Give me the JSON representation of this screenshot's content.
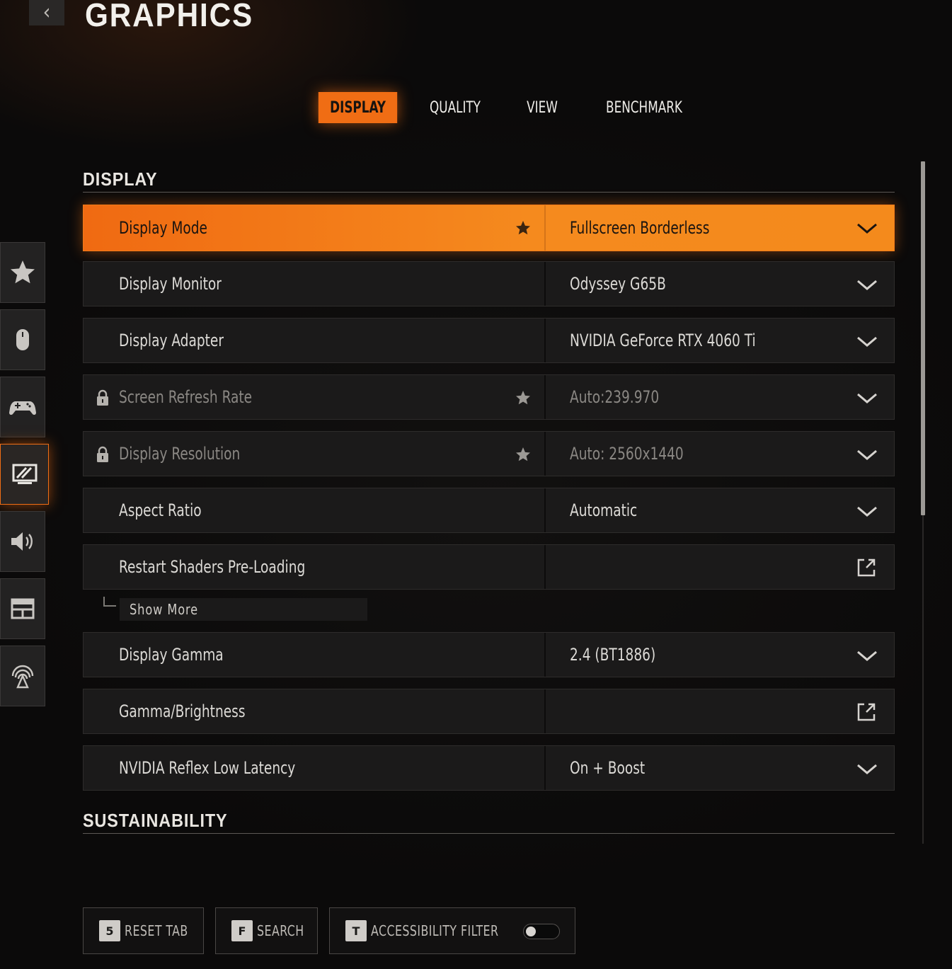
{
  "header": {
    "title": "GRAPHICS",
    "back_icon": "chevron-left-icon"
  },
  "tabs": [
    {
      "label": "DISPLAY",
      "active": true
    },
    {
      "label": "QUALITY",
      "active": false
    },
    {
      "label": "VIEW",
      "active": false
    },
    {
      "label": "BENCHMARK",
      "active": false
    }
  ],
  "sections": {
    "display": "DISPLAY",
    "sustainability": "SUSTAINABILITY"
  },
  "settings": [
    {
      "label": "Display Mode",
      "value": "Fullscreen Borderless",
      "control": "dropdown",
      "starred": true,
      "locked": false,
      "highlighted": true
    },
    {
      "label": "Display Monitor",
      "value": "Odyssey G65B",
      "control": "dropdown",
      "starred": false,
      "locked": false
    },
    {
      "label": "Display Adapter",
      "value": "NVIDIA GeForce RTX 4060 Ti",
      "control": "dropdown",
      "starred": false,
      "locked": false
    },
    {
      "label": "Screen Refresh Rate",
      "value": "Auto:239.970",
      "control": "dropdown",
      "starred": true,
      "locked": true
    },
    {
      "label": "Display Resolution",
      "value": "Auto: 2560x1440",
      "control": "dropdown",
      "starred": true,
      "locked": true
    },
    {
      "label": "Aspect Ratio",
      "value": "Automatic",
      "control": "dropdown",
      "starred": false,
      "locked": false
    },
    {
      "label": "Restart Shaders Pre-Loading",
      "value": "",
      "control": "external",
      "starred": false,
      "locked": false
    },
    {
      "label": "Display Gamma",
      "value": "2.4 (BT1886)",
      "control": "dropdown",
      "starred": false,
      "locked": false
    },
    {
      "label": "Gamma/Brightness",
      "value": "",
      "control": "external",
      "starred": false,
      "locked": false
    },
    {
      "label": "NVIDIA Reflex Low Latency",
      "value": "On + Boost",
      "control": "dropdown",
      "starred": false,
      "locked": false
    }
  ],
  "show_more": {
    "label": "Show More"
  },
  "sidebar": [
    {
      "icon": "star-icon",
      "active": false
    },
    {
      "icon": "mouse-icon",
      "active": false
    },
    {
      "icon": "gamepad-icon",
      "active": false
    },
    {
      "icon": "monitor-icon",
      "active": true
    },
    {
      "icon": "speaker-icon",
      "active": false
    },
    {
      "icon": "layout-icon",
      "active": false
    },
    {
      "icon": "network-icon",
      "active": false
    }
  ],
  "footer": {
    "reset": {
      "key": "5",
      "label": "RESET TAB"
    },
    "search": {
      "key": "F",
      "label": "SEARCH"
    },
    "accessibility": {
      "key": "T",
      "label": "ACCESSIBILITY FILTER",
      "toggle_on": false
    }
  },
  "colors": {
    "accent": "#f06d14",
    "row_bg": "#1b1a1a",
    "text": "#dcdad6",
    "locked_text": "#8a8783"
  }
}
